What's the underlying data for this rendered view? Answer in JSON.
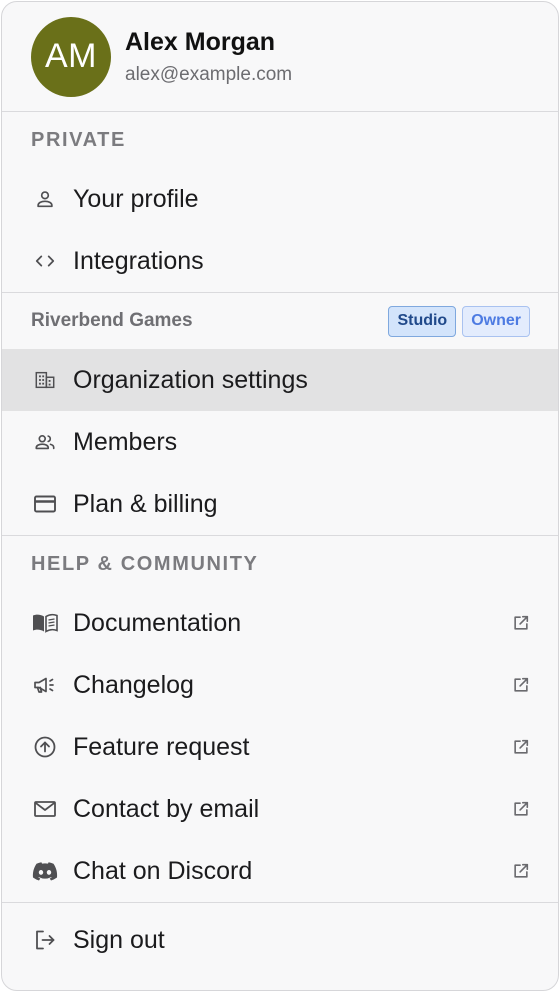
{
  "user": {
    "initials": "AM",
    "name": "Alex Morgan",
    "email": "alex@example.com",
    "avatar_color": "#6a7019"
  },
  "private": {
    "title": "PRIVATE",
    "items": [
      {
        "label": "Your profile",
        "icon": "person-icon"
      },
      {
        "label": "Integrations",
        "icon": "code-icon"
      }
    ]
  },
  "org": {
    "name": "Riverbend Games",
    "badges": [
      "Studio",
      "Owner"
    ],
    "items": [
      {
        "label": "Organization settings",
        "icon": "building-icon",
        "active": true
      },
      {
        "label": "Members",
        "icon": "people-icon"
      },
      {
        "label": "Plan & billing",
        "icon": "credit-card-icon"
      }
    ]
  },
  "help": {
    "title": "HELP & COMMUNITY",
    "items": [
      {
        "label": "Documentation",
        "icon": "book-icon",
        "external": true
      },
      {
        "label": "Changelog",
        "icon": "megaphone-icon",
        "external": true
      },
      {
        "label": "Feature request",
        "icon": "arrow-up-circle-icon",
        "external": true
      },
      {
        "label": "Contact by email",
        "icon": "mail-icon",
        "external": true
      },
      {
        "label": "Chat on Discord",
        "icon": "discord-icon",
        "external": true
      }
    ]
  },
  "signout": {
    "label": "Sign out",
    "icon": "sign-out-icon"
  },
  "colors": {
    "accent_badge_studio": "#d3e4fb",
    "accent_badge_owner": "#e3ecfd",
    "active_row": "#e2e2e3"
  }
}
